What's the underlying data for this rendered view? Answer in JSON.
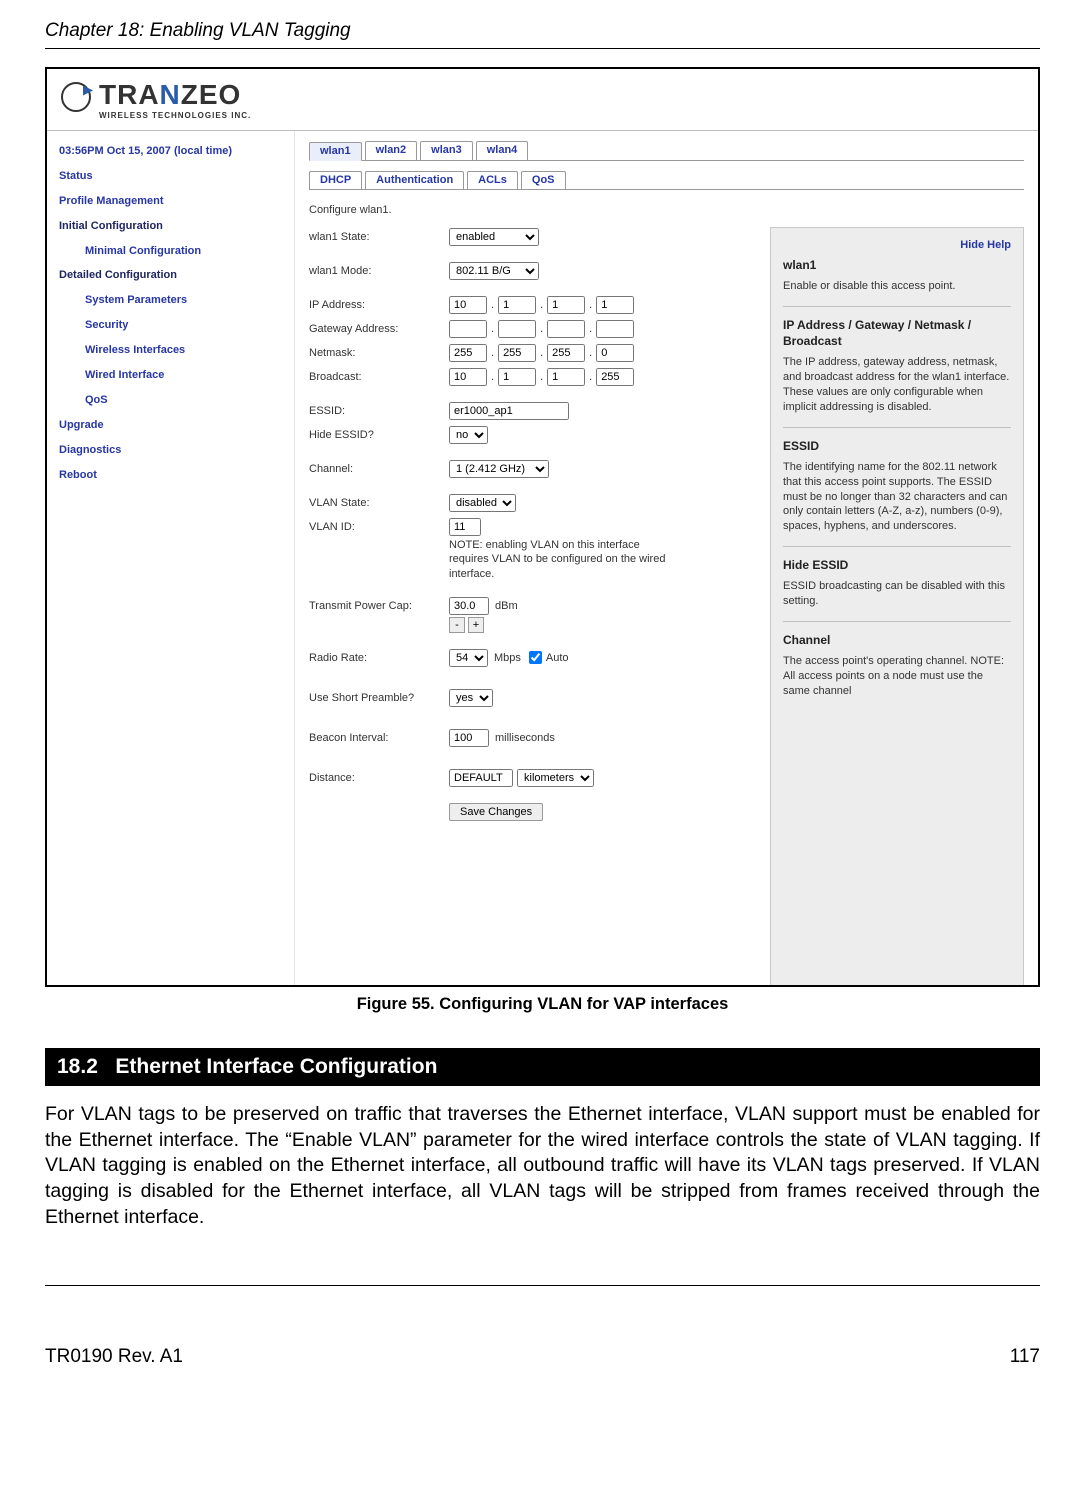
{
  "chapter_title": "Chapter 18: Enabling VLAN Tagging",
  "logo": {
    "main": "TRA",
    "n": "N",
    "rest": "ZEO",
    "sub": "WIRELESS  TECHNOLOGIES INC."
  },
  "sidebar": {
    "time": "03:56PM Oct 15, 2007 (local time)",
    "status": "Status",
    "profile": "Profile Management",
    "initial": "Initial Configuration",
    "minimal": "Minimal Configuration",
    "detailed": "Detailed Configuration",
    "sysparams": "System Parameters",
    "security": "Security",
    "wireless": "Wireless Interfaces",
    "wired": "Wired Interface",
    "qos": "QoS",
    "upgrade": "Upgrade",
    "diagnostics": "Diagnostics",
    "reboot": "Reboot"
  },
  "tabs_primary": {
    "t1": "wlan1",
    "t2": "wlan2",
    "t3": "wlan3",
    "t4": "wlan4"
  },
  "tabs_secondary": {
    "t1": "DHCP",
    "t2": "Authentication",
    "t3": "ACLs",
    "t4": "QoS"
  },
  "form": {
    "desc": "Configure wlan1.",
    "state_label": "wlan1 State:",
    "state_value": "enabled",
    "mode_label": "wlan1 Mode:",
    "mode_value": "802.11 B/G",
    "ip_label": "IP Address:",
    "ip": {
      "a": "10",
      "b": "1",
      "c": "1",
      "d": "1"
    },
    "gw_label": "Gateway Address:",
    "gw": {
      "a": "",
      "b": "",
      "c": "",
      "d": ""
    },
    "nm_label": "Netmask:",
    "nm": {
      "a": "255",
      "b": "255",
      "c": "255",
      "d": "0"
    },
    "bc_label": "Broadcast:",
    "bc": {
      "a": "10",
      "b": "1",
      "c": "1",
      "d": "255"
    },
    "essid_label": "ESSID:",
    "essid_value": "er1000_ap1",
    "hide_essid_label": "Hide ESSID?",
    "hide_essid_value": "no",
    "channel_label": "Channel:",
    "channel_value": "1 (2.412 GHz)",
    "vlan_state_label": "VLAN State:",
    "vlan_state_value": "disabled",
    "vlan_id_label": "VLAN ID:",
    "vlan_id_value": "11",
    "vlan_note": "NOTE: enabling VLAN on this interface requires VLAN to be configured on the wired interface.",
    "txpower_label": "Transmit Power Cap:",
    "txpower_value": "30.0",
    "txpower_unit": "dBm",
    "minus": "-",
    "plus": "+",
    "radio_label": "Radio Rate:",
    "radio_value": "54",
    "mbps": "Mbps",
    "auto": "Auto",
    "preamble_label": "Use Short Preamble?",
    "preamble_value": "yes",
    "beacon_label": "Beacon Interval:",
    "beacon_value": "100",
    "beacon_unit": "milliseconds",
    "distance_label": "Distance:",
    "distance_value": "DEFAULT",
    "distance_unit": "kilometers",
    "save": "Save Changes"
  },
  "help": {
    "hide": "Hide Help",
    "h1": "wlan1",
    "p1": "Enable or disable this access point.",
    "h2": "IP Address / Gateway / Netmask / Broadcast",
    "p2": "The IP address, gateway address, netmask, and broadcast address for the wlan1 interface. These values are only configurable when implicit addressing is disabled.",
    "h3": "ESSID",
    "p3": "The identifying name for the 802.11 network that this access point supports. The ESSID must be no longer than 32 characters and can only contain letters (A-Z, a-z), numbers (0-9), spaces, hyphens, and underscores.",
    "h4": "Hide ESSID",
    "p4": "ESSID broadcasting can be disabled with this setting.",
    "h5": "Channel",
    "p5": "The access point's operating channel. NOTE: All access points on a node must use the same channel"
  },
  "figure_caption": "Figure 55. Configuring VLAN for VAP interfaces",
  "section": {
    "num": "18.2",
    "title": "Ethernet Interface Configuration"
  },
  "body_text": "For VLAN tags to be preserved on traffic that traverses the Ethernet interface, VLAN support must be enabled for the Ethernet interface. The “Enable VLAN” parameter for the wired interface controls the state of VLAN tagging. If VLAN tagging is enabled on the Ethernet interface, all outbound traffic will have its VLAN tags preserved. If VLAN tagging is disabled for the Ethernet interface, all VLAN tags will be stripped from frames received through the Ethernet interface.",
  "footer": {
    "doc": "TR0190 Rev. A1",
    "page": "117"
  }
}
